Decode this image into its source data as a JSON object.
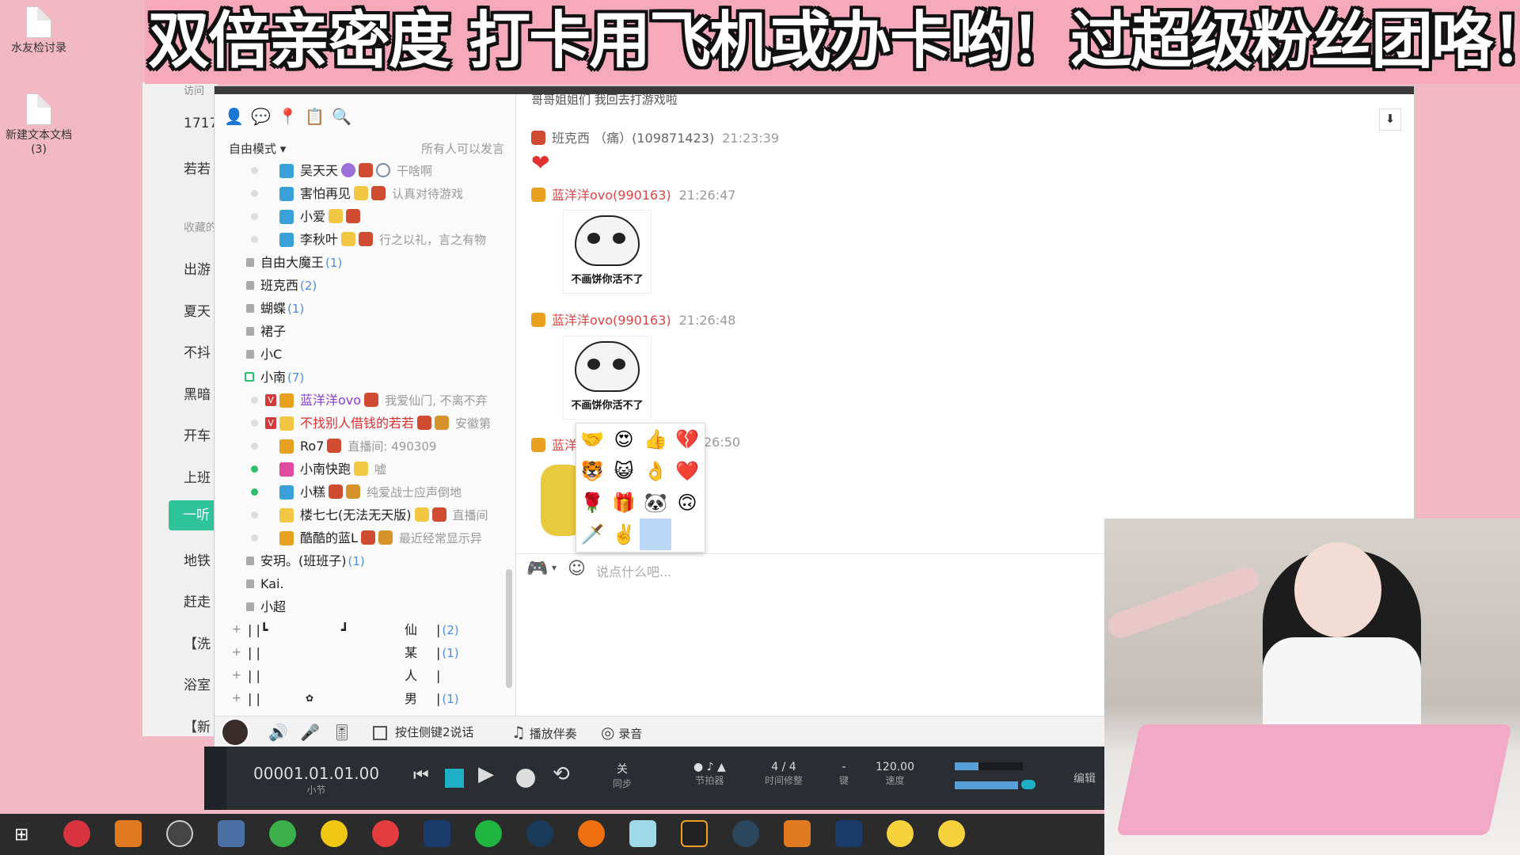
{
  "banner": {
    "text": "双倍亲密度 打卡用飞机或办卡哟！过超级粉丝团咯！"
  },
  "desktop": {
    "icons": [
      {
        "label": "水友检讨录"
      },
      {
        "label": "新建文本文档(3)"
      }
    ]
  },
  "bg_window": {
    "items": [
      "访问",
      "1717",
      "若若",
      "收藏的",
      "出游",
      "夏天",
      "不抖",
      "黑暗",
      "开车",
      "上班",
      "一听",
      "地铁",
      "赶走",
      "【洗",
      "浴室",
      "【新"
    ]
  },
  "yy": {
    "left_panel": {
      "tool_icons": [
        "user-icon",
        "chat-icon",
        "location-icon",
        "list-icon",
        "search-icon"
      ],
      "mode": "自由模式 ▾",
      "mode_hint": "所有人可以发言",
      "members_top": [
        {
          "name": "吴天天",
          "sign": "干啥啊"
        },
        {
          "name": "害怕再见",
          "sign": "认真对待游戏"
        },
        {
          "name": "小爱",
          "sign": ""
        },
        {
          "name": "李秋叶",
          "sign": "行之以礼，言之有物"
        }
      ],
      "channels": [
        {
          "name": "自由大魔王",
          "count": "(1)"
        },
        {
          "name": "班克西",
          "count": "(2)"
        },
        {
          "name": "蝴蝶",
          "count": "(1)"
        },
        {
          "name": "裙子",
          "count": ""
        },
        {
          "name": "小C",
          "count": ""
        },
        {
          "name": "小南",
          "count": "(7)"
        }
      ],
      "members_room": [
        {
          "name": "蓝洋洋ovo",
          "sign": "我爱仙门, 不离不弃"
        },
        {
          "name": "不找别人借钱的若若",
          "sign": "安徽第"
        },
        {
          "name": "Ro7",
          "sign": "直播间: 490309"
        },
        {
          "name": "小南快跑",
          "sign": "嘘"
        },
        {
          "name": "小糕",
          "sign": "纯爱战士应声倒地"
        },
        {
          "name": "楼七七(无法无天版)",
          "sign": "直播间"
        },
        {
          "name": "酷酷的蓝L",
          "sign": "最近经常显示异"
        }
      ],
      "channels_bottom": [
        {
          "name": "安玥。(班班子)",
          "count": "(1)"
        },
        {
          "name": "Kai.",
          "count": ""
        },
        {
          "name": "小超",
          "count": ""
        }
      ],
      "groups": [
        {
          "mid": "仙",
          "count": "(2)"
        },
        {
          "mid": "某",
          "count": "(1)"
        },
        {
          "mid": "人",
          "count": ""
        },
        {
          "mid": "男",
          "count": "(1)"
        }
      ]
    },
    "chat": {
      "top_cut": "哥哥姐姐们 我回去打游戏啦",
      "messages": [
        {
          "user": "班克西 （痛）(109871423)",
          "time": "21:23:39"
        },
        {
          "user": "蓝洋洋ovo(990163)",
          "time": "21:26:47",
          "caption": "不画饼你活不了"
        },
        {
          "user": "蓝洋洋ovo(990163)",
          "time": "21:26:48",
          "caption": "不画饼你活不了"
        },
        {
          "user": "蓝洋",
          "time": "26:50"
        }
      ],
      "scroll_down": "⬇"
    },
    "emoji_picker": {
      "items": [
        "🤝",
        "😍",
        "👍",
        "💔",
        "🐯",
        "😺",
        "👌",
        "❤️",
        "🌹",
        "🎁",
        "🐼",
        "🙃",
        "🗡️",
        "✌️",
        "",
        ""
      ]
    },
    "input": {
      "placeholder": "说点什么吧..."
    },
    "voice_bar": {
      "ptt": "按住侧键2说话",
      "accompany": "播放伴奏",
      "record": "录音"
    }
  },
  "daw": {
    "position": "00001.01.01.00",
    "position_sub": "小节",
    "sync_top": "关",
    "sync_sub": "同步",
    "metronome": "节拍器",
    "timesig": "4 / 4",
    "timesig_sub": "时间修整",
    "key": "-",
    "key_sub": "键",
    "tempo": "120.00",
    "tempo_sub": "速度",
    "edit": "编辑"
  },
  "taskbar": {
    "colors": [
      "#ffffff",
      "#d8343f",
      "#e07a20",
      "#e0e0e0",
      "#4a6fa5",
      "#3cae4a",
      "#f0c814",
      "#e33d3d",
      "#1a3a6a",
      "#1fb540",
      "#1a3a5a",
      "#f07010",
      "#9fd9e8",
      "#222222",
      "#2a475e",
      "#e07a20",
      "#1a3a6a",
      "#f6d23c",
      "#f6d23c"
    ]
  }
}
